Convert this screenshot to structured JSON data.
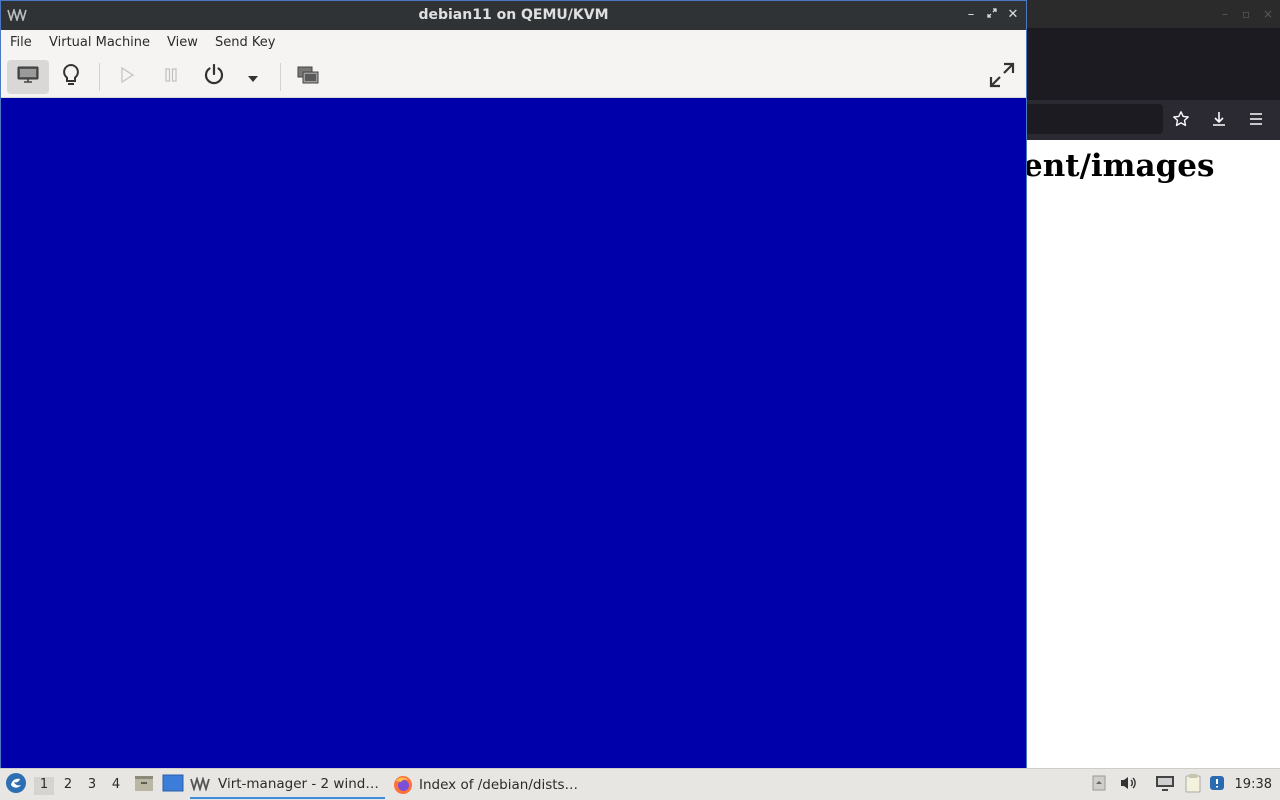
{
  "browser": {
    "heading": "ent/images"
  },
  "vm_window": {
    "title": "debian11 on QEMU/KVM",
    "menu": [
      "File",
      "Virtual Machine",
      "View",
      "Send Key"
    ],
    "display_color": "#0000aa"
  },
  "taskbar": {
    "workspaces": [
      "1",
      "2",
      "3",
      "4"
    ],
    "active_workspace": "1",
    "tasks": [
      {
        "label": "Virt-manager - 2 wind…",
        "icon": "virt-manager-icon"
      },
      {
        "label": "Index of /debian/dists…",
        "icon": "firefox-icon"
      }
    ],
    "clock": "19:38"
  },
  "colors": {
    "accent": "#3e8edb",
    "vm_screen": "#0000aa",
    "titlebar": "#2f3336"
  }
}
